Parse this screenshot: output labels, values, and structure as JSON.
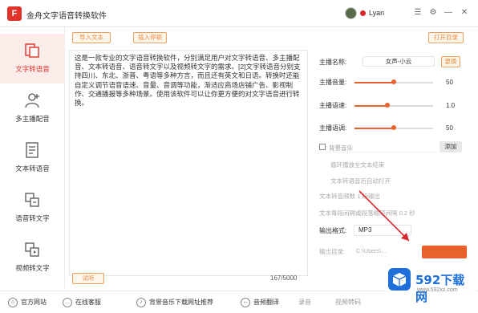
{
  "app": {
    "title": "金舟文字语音转换软件",
    "logo_letter": "F",
    "user_name": "Lyan"
  },
  "sidebar": {
    "items": [
      {
        "label": "文字转语音",
        "icon": "text-to-speech-icon",
        "active": true
      },
      {
        "label": "多主播配音",
        "icon": "multi-host-icon",
        "active": false
      },
      {
        "label": "文本转语音",
        "icon": "document-to-speech-icon",
        "active": false
      },
      {
        "label": "语音转文字",
        "icon": "speech-to-text-icon",
        "active": false
      },
      {
        "label": "视频转文字",
        "icon": "video-to-text-icon",
        "active": false
      }
    ]
  },
  "toolbar": {
    "import_text": "导入文本",
    "clear_text": "插入停顿",
    "open_output": "打开目录"
  },
  "editor": {
    "content": "这是一款专业的文字语音转换软件，分别满足用户对文字转语音、多主播配音、文本转语音、语音转文字以及视频转文字的需求。[2]文字转语音分别支持四川、东北、浙普、粤语等多种方言，而且还有英文和日语。转换时还能自定义调节语音语速、音量、音调等功能，渐适应商场店铺广告、影视制作、交通播报等多种场景。使用该软件可以让你更方便的对文字语音进行转换。",
    "char_count": "167/5000",
    "bottom_button": "试听"
  },
  "settings": {
    "voice_label": "主播名称:",
    "voice_value": "女声-小云",
    "voice_button": "更换",
    "volume_label": "主播音量:",
    "volume_value": "50",
    "volume_level": 0.5,
    "speed_label": "主播语速:",
    "speed_value": "1.0",
    "speed_level": 0.42,
    "pitch_label": "主播语调:",
    "pitch_value": "50",
    "pitch_level": 0.5,
    "bgm_label": "背景音乐",
    "bgm_button": "添加",
    "faint_1": "循环播放全文本结束",
    "faint_2": "文本转语音后自动打开",
    "faint_3": "文本转音频数  1  段输出",
    "faint_4": "文本每段间隔或段落缩短间隔 0.2  秒",
    "format_label": "输出格式:",
    "format_value": "MP3",
    "output_label": "输出目录:",
    "output_value": "C:\\Users\\..."
  },
  "bottombar": {
    "official_site": "官方网站",
    "online_service": "在线客服",
    "recommend": "背景音乐下载网址推荐",
    "voice_text": "音频翻译",
    "record": "录音",
    "video_convert": "视频转码"
  },
  "watermark": {
    "brand": "592下载网",
    "url": "www.592xz.com"
  },
  "colors": {
    "accent": "#e0342a",
    "orange": "#e98a3c",
    "slider": "#e9622b",
    "watermark_blue": "#1e6fd9"
  }
}
